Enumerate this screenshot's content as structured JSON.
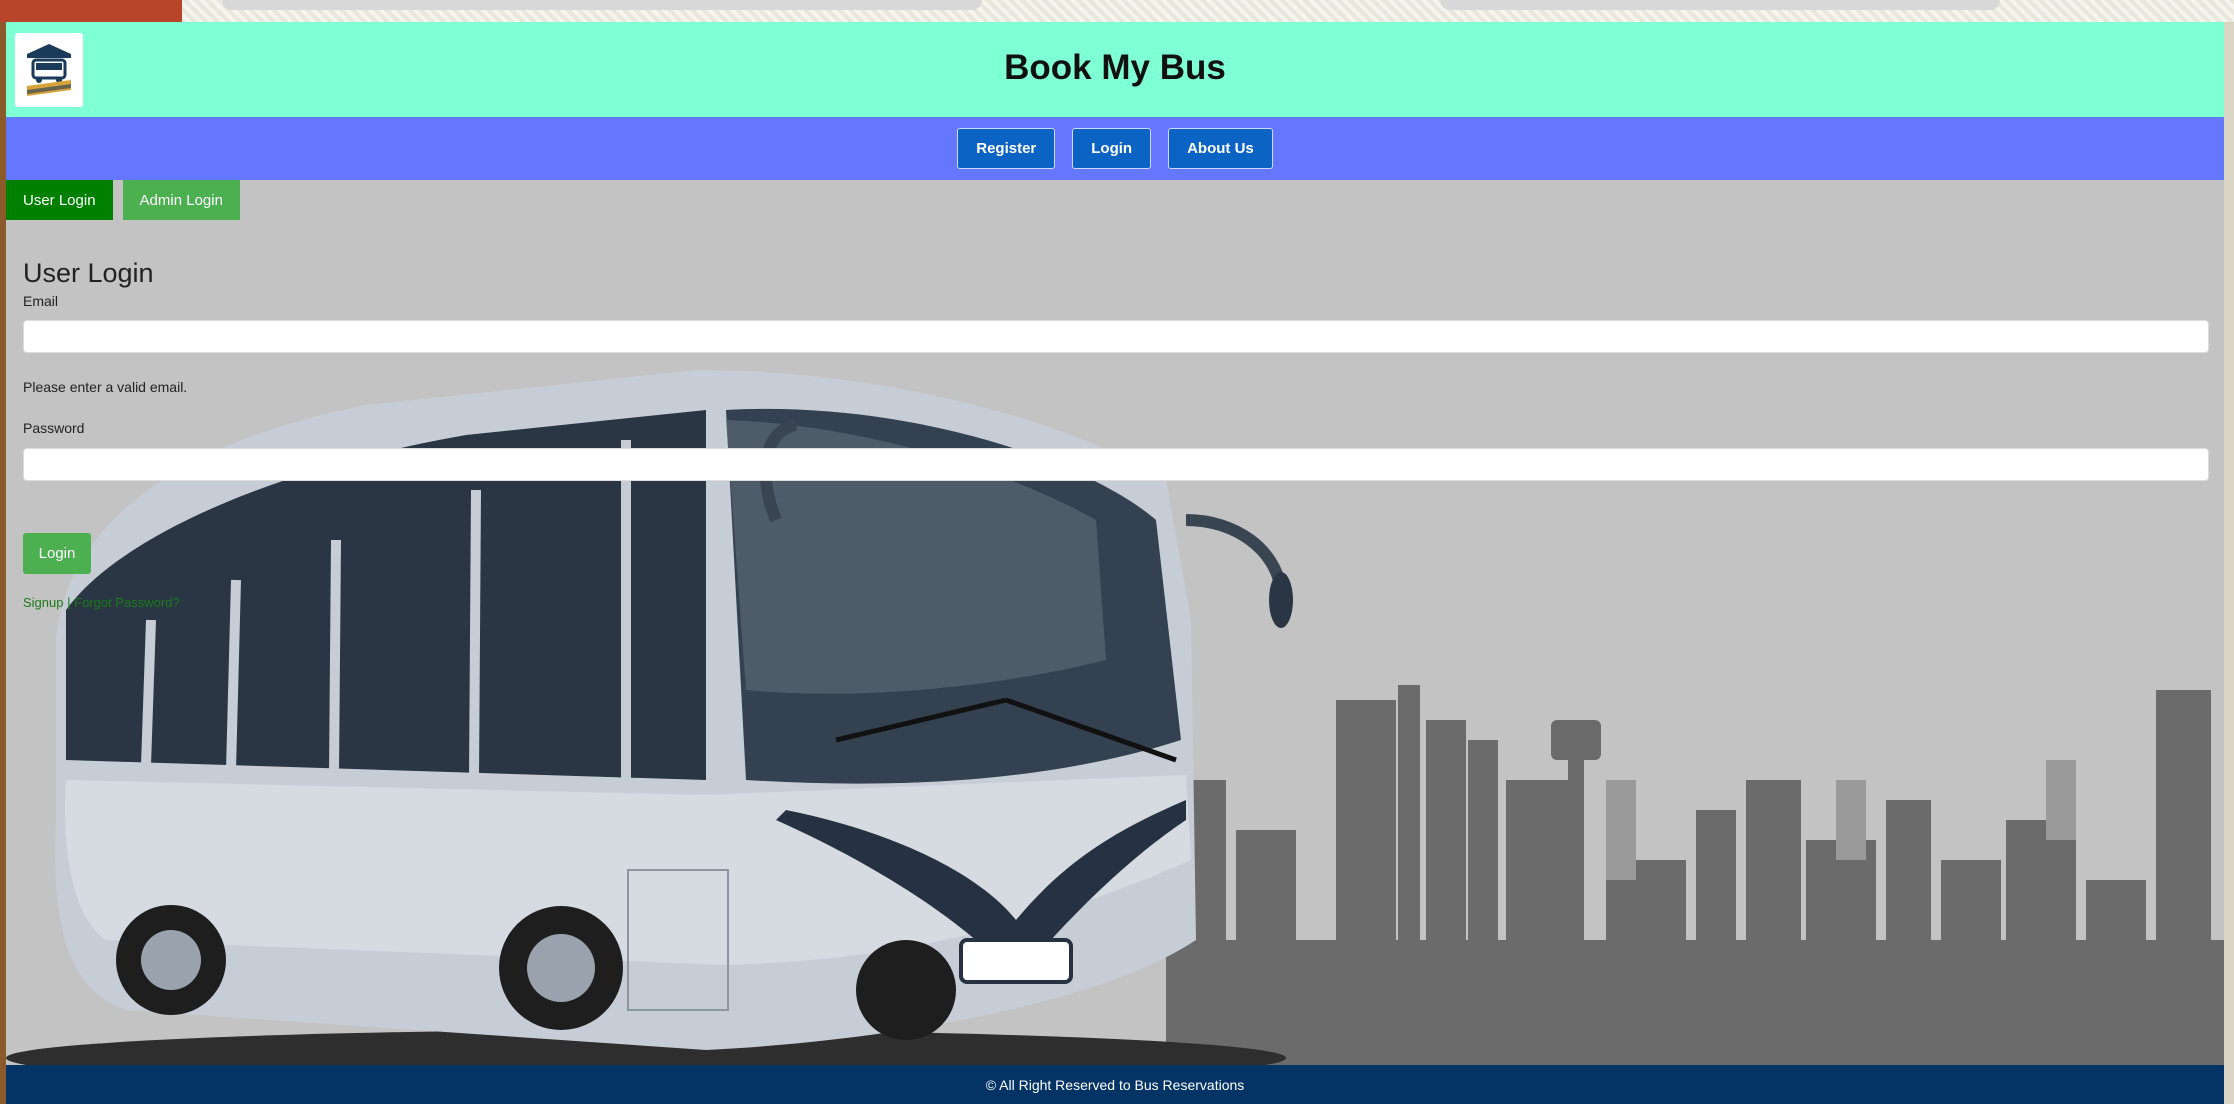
{
  "header": {
    "title": "Book My Bus"
  },
  "nav": {
    "items": [
      {
        "label": "Register"
      },
      {
        "label": "Login"
      },
      {
        "label": "About Us"
      }
    ]
  },
  "tabs": [
    {
      "label": "User Login",
      "active": true
    },
    {
      "label": "Admin Login",
      "active": false
    }
  ],
  "form": {
    "title": "User Login",
    "email_label": "Email",
    "email_value": "",
    "email_hint": "Please enter a valid email.",
    "password_label": "Password",
    "password_value": "",
    "submit_label": "Login",
    "signup_link": "Signup",
    "separator": "|",
    "forgot_link": "Forgot Password?"
  },
  "footer": {
    "text": "© All Right Reserved to Bus Reservations"
  },
  "colors": {
    "header_bg": "#7fffd4",
    "nav_bg": "#6677ff",
    "nav_button": "#0b63c4",
    "active_tab": "#008000",
    "inactive_tab": "#4caf50",
    "footer_bg": "#043366"
  }
}
